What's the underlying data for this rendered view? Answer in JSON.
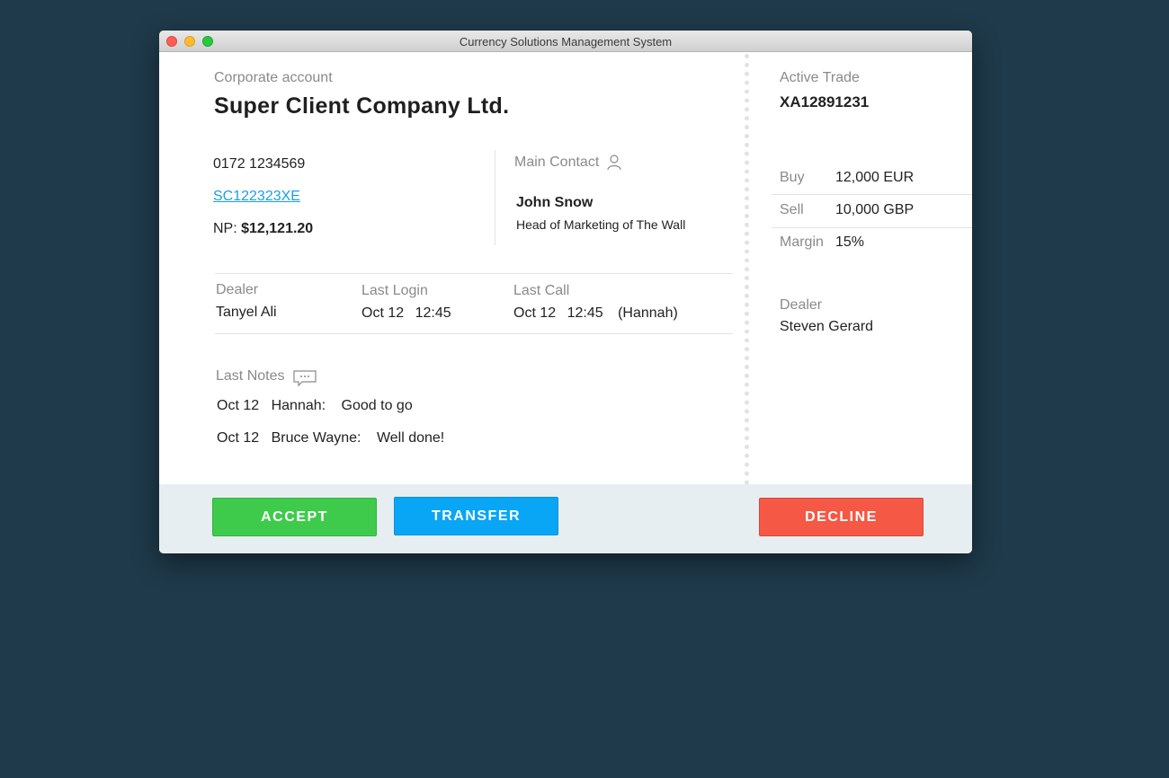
{
  "window": {
    "title": "Currency Solutions Management System"
  },
  "account": {
    "type_label": "Corporate account",
    "company": "Super Client Company Ltd.",
    "phone": "0172 1234569",
    "account_id": "SC122323XE",
    "np_label": "NP:",
    "np_value": "$12,121.20"
  },
  "contact": {
    "label": "Main Contact",
    "name": "John Snow",
    "role": "Head of Marketing of The Wall"
  },
  "activity": {
    "dealer_label": "Dealer",
    "dealer_value": "Tanyel Ali",
    "last_login_label": "Last Login",
    "last_login_date": "Oct 12",
    "last_login_time": "12:45",
    "last_call_label": "Last Call",
    "last_call_date": "Oct 12",
    "last_call_time": "12:45",
    "last_call_by": "(Hannah)"
  },
  "notes": {
    "label": "Last Notes",
    "items": [
      {
        "date": "Oct 12",
        "author": "Hannah:",
        "text": "Good to go"
      },
      {
        "date": "Oct 12",
        "author": "Bruce Wayne:",
        "text": "Well done!"
      }
    ]
  },
  "trade": {
    "label": "Active Trade",
    "id": "XA12891231",
    "buy_label": "Buy",
    "buy_value": "12,000 EUR",
    "sell_label": "Sell",
    "sell_value": "10,000 GBP",
    "margin_label": "Margin",
    "margin_value": "15%",
    "dealer_label": "Dealer",
    "dealer_value": "Steven Gerard"
  },
  "actions": {
    "accept": "ACCEPT",
    "transfer": "TRANSFER",
    "decline": "DECLINE"
  },
  "icons": {
    "contact": "person-icon",
    "notes": "speech-bubble-icon"
  },
  "colors": {
    "accept": "#3ecb4c",
    "transfer": "#08a6f5",
    "decline": "#f55845",
    "link": "#1a9ee8",
    "background": "#1f3a4a"
  }
}
